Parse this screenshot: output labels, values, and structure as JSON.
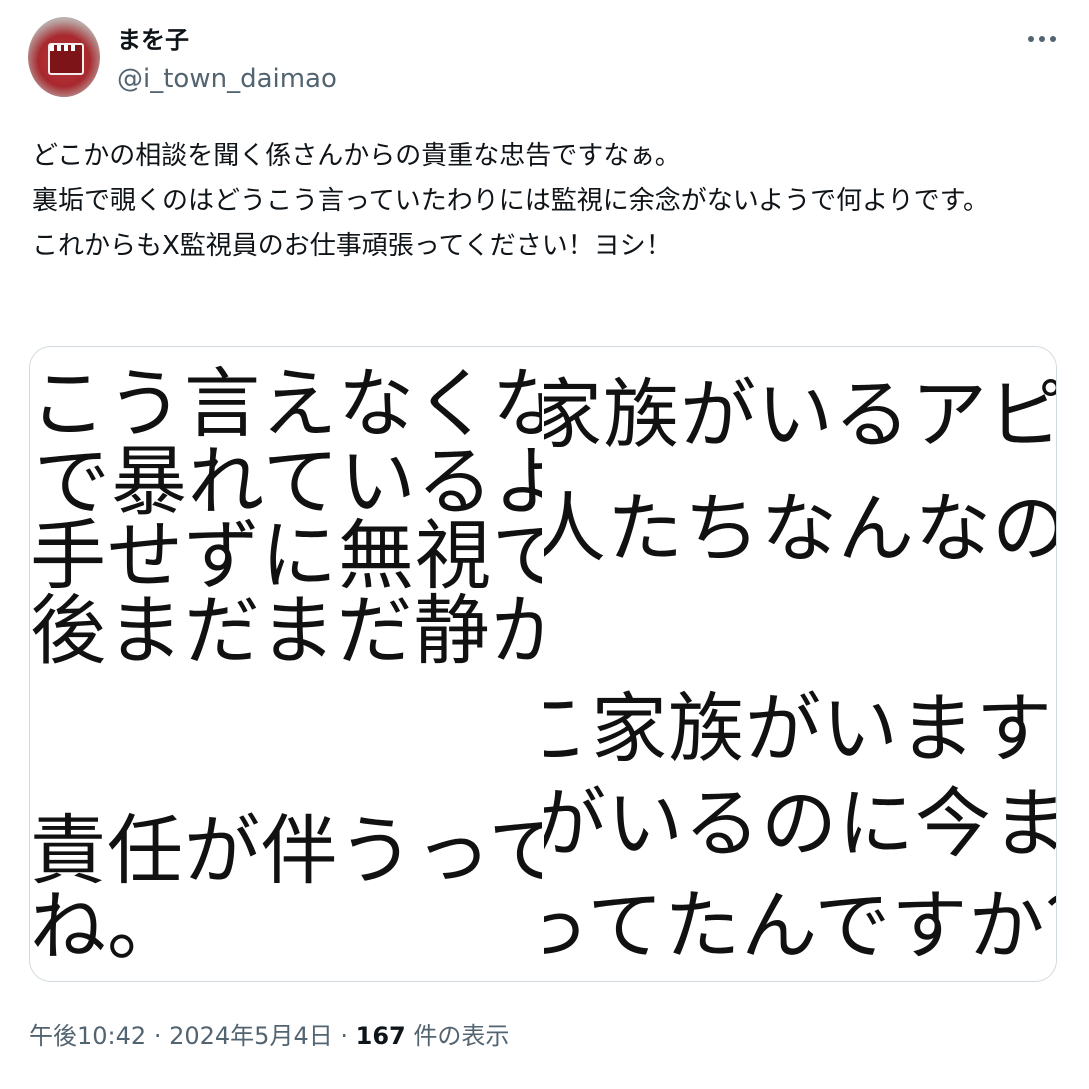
{
  "author": {
    "display_name": "まを子",
    "handle": "@i_town_daimao"
  },
  "tweet": {
    "lines": [
      "どこかの相談を聞く係さんからの貴重な忠告ですなぁ。",
      "裏垢で覗くのはどうこう言っていたわりには監視に余念がないようで何よりです。",
      "これからもX監視員のお仕事頑張ってください！ヨシ！"
    ]
  },
  "media": {
    "left_lines": [
      "こう言えなくなった人",
      "で暴れているようです",
      "手せずに無視でいいで",
      "後まだまだ静かになり",
      "責任が伴うって十分に",
      "ね。"
    ],
    "right_lines": [
      "家族がいるアピー",
      "人たちなんなの(笑",
      "こ家族がいますけ",
      "がいるのに今まで",
      "ってたんですか？"
    ]
  },
  "meta": {
    "time": "午後10:42",
    "sep1": "·",
    "date": "2024年5月4日",
    "sep2": "·",
    "view_count": "167",
    "view_label": "件の表示"
  },
  "icons": {
    "more": "more-horizontal-icon"
  },
  "colors": {
    "secondary_text": "#536471",
    "primary_text": "#0f1419",
    "border": "#cfd9de"
  }
}
